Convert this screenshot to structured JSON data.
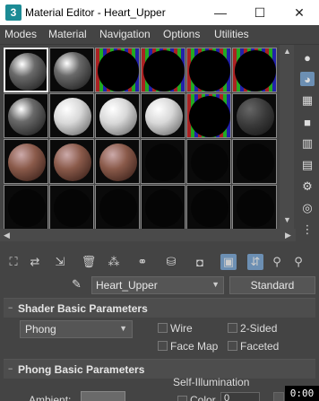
{
  "window": {
    "app_icon": "3",
    "title": "Material Editor - Heart_Upper",
    "minimize": "—",
    "maximize": "☐",
    "close": "✕"
  },
  "menu": [
    "Modes",
    "Material",
    "Navigation",
    "Options",
    "Utilities"
  ],
  "slots": {
    "rows": [
      [
        "gray-selected",
        "gray-sphere",
        "empty",
        "empty",
        "empty",
        "empty"
      ],
      [
        "gray-sphere",
        "white-sphere",
        "white-sphere",
        "white-sphere",
        "empty",
        "dark-gray-sphere"
      ],
      [
        "skin-sphere",
        "skin-sphere",
        "skin-sphere",
        "black",
        "black",
        "black"
      ],
      [
        "black",
        "black",
        "black",
        "black",
        "black",
        "black"
      ]
    ],
    "colors": {
      "gray": "#6a6a6a",
      "white": "#d8d8d8",
      "dark_gray": "#3a3a3a",
      "skin": "#8a5a4a",
      "black": "#050505"
    }
  },
  "right_toolbar_icons": [
    "sphere-icon",
    "sample-type-icon",
    "backlight-icon",
    "background-icon",
    "uv-tiling-icon",
    "video-color-check-icon",
    "make-preview-icon",
    "options-icon",
    "select-by-material-icon",
    "material-map-navigator-icon"
  ],
  "bottom_toolbar_icons": [
    "get-material-icon",
    "put-to-scene-icon",
    "assign-to-selection-icon",
    "reset-map-icon",
    "copy-material-icon",
    "make-unique-icon",
    "put-to-library-icon",
    "material-id-icon",
    "show-shaded-icon",
    "show-end-result-icon",
    "go-to-parent-icon",
    "go-forward-sibling-icon"
  ],
  "material_name": "Heart_Upper",
  "material_type": "Standard",
  "shader_rollout": {
    "title": "Shader Basic Parameters",
    "shader": "Phong",
    "wire": "Wire",
    "two_sided": "2-Sided",
    "face_map": "Face Map",
    "faceted": "Faceted"
  },
  "phong_rollout": {
    "title": "Phong Basic Parameters",
    "self_illumination": "Self-Illumination",
    "ambient": "Ambient:",
    "color": "Color",
    "color_value": "0"
  },
  "timer": "0:00"
}
